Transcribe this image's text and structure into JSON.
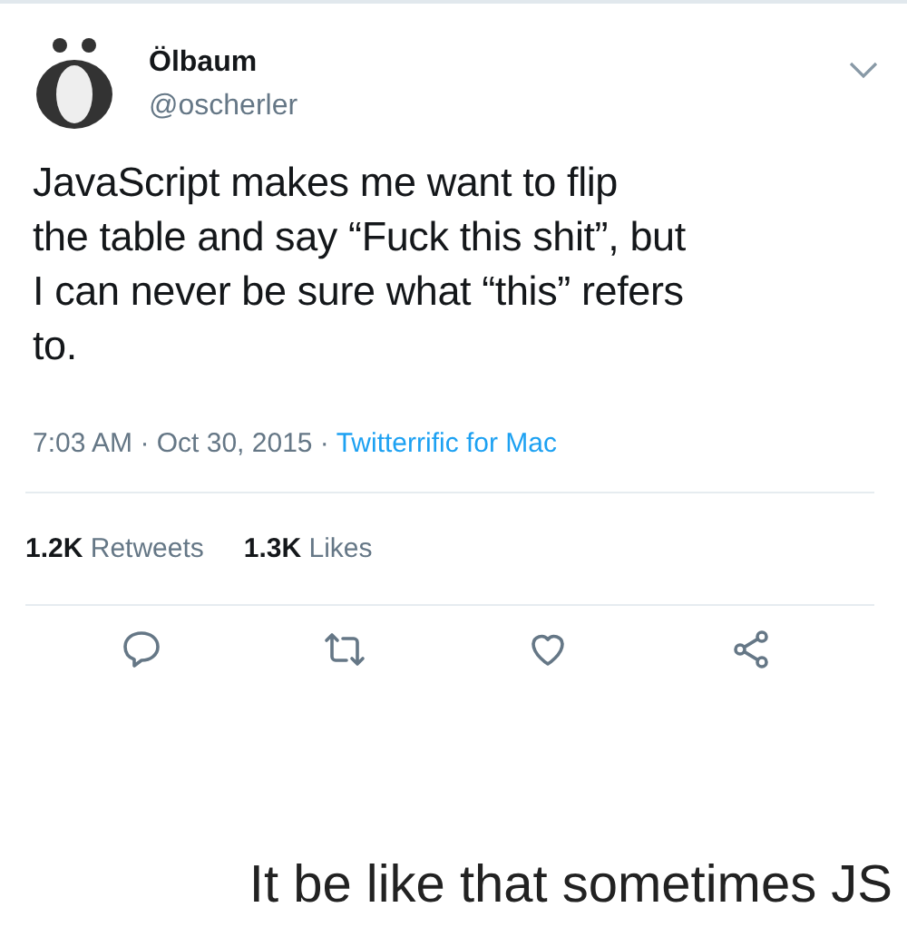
{
  "tweet": {
    "name": "Ölbaum",
    "handle": "@oscherler",
    "text_lines": [
      "JavaScript makes me want to flip",
      "the table and say “Fuck this shit”, but",
      "I can never be sure what “this” refers",
      "to."
    ],
    "time": "7:03 AM · Oct 30, 2015 · ",
    "client": "Twitterrific for Mac",
    "stats": [
      {
        "count": "1.2K",
        "label": "Retweets"
      },
      {
        "count": "1.3K",
        "label": "Likes"
      }
    ],
    "actions": [
      {
        "kind": "reply"
      },
      {
        "kind": "retweet"
      },
      {
        "kind": "like"
      },
      {
        "kind": "share"
      }
    ]
  },
  "caption": "It be like that sometimes JS"
}
